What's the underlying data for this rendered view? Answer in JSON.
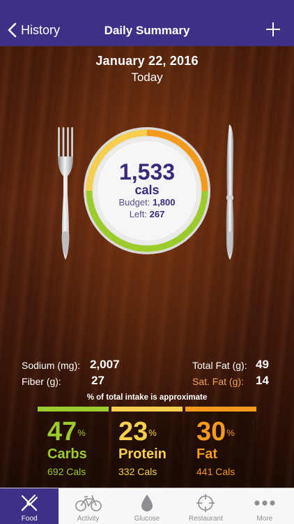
{
  "nav": {
    "back_label": "History",
    "title": "Daily Summary"
  },
  "date": {
    "main": "January 22, 2016",
    "sub": "Today"
  },
  "plate": {
    "calories": "1,533",
    "unit": "cals",
    "budget_label": "Budget:",
    "budget_value": "1,800",
    "left_label": "Left:",
    "left_value": "267"
  },
  "nutrients": {
    "sodium": {
      "label": "Sodium (mg):",
      "value": "2,007"
    },
    "fiber": {
      "label": "Fiber (g):",
      "value": "27"
    },
    "total_fat": {
      "label": "Total Fat (g):",
      "value": "49"
    },
    "sat_fat": {
      "label": "Sat. Fat (g):",
      "value": "14"
    }
  },
  "approx_note": "% of total intake is approximate",
  "macros": [
    {
      "percent": "47",
      "symbol": "%",
      "name": "Carbs",
      "cals": "692 Cals",
      "color": "#9ccb2c"
    },
    {
      "percent": "23",
      "symbol": "%",
      "name": "Protein",
      "cals": "332 Cals",
      "color": "#f6cf4e"
    },
    {
      "percent": "30",
      "symbol": "%",
      "name": "Fat",
      "cals": "441 Cals",
      "color": "#f39a1c"
    }
  ],
  "tabs": [
    {
      "label": "Food",
      "icon": "fork-knife-icon",
      "active": true
    },
    {
      "label": "Activity",
      "icon": "bicycle-icon",
      "active": false
    },
    {
      "label": "Glucose",
      "icon": "drop-icon",
      "active": false
    },
    {
      "label": "Restaurant",
      "icon": "crosshair-icon",
      "active": false
    },
    {
      "label": "More",
      "icon": "more-dots-icon",
      "active": false
    }
  ],
  "colors": {
    "nav_bar": "#3f2f86",
    "plate_text": "#3b2a7c",
    "sat_fat_label": "#f2a25a",
    "carbs": "#9ccb2c",
    "protein": "#f6cf4e",
    "fat": "#f39a1c"
  }
}
